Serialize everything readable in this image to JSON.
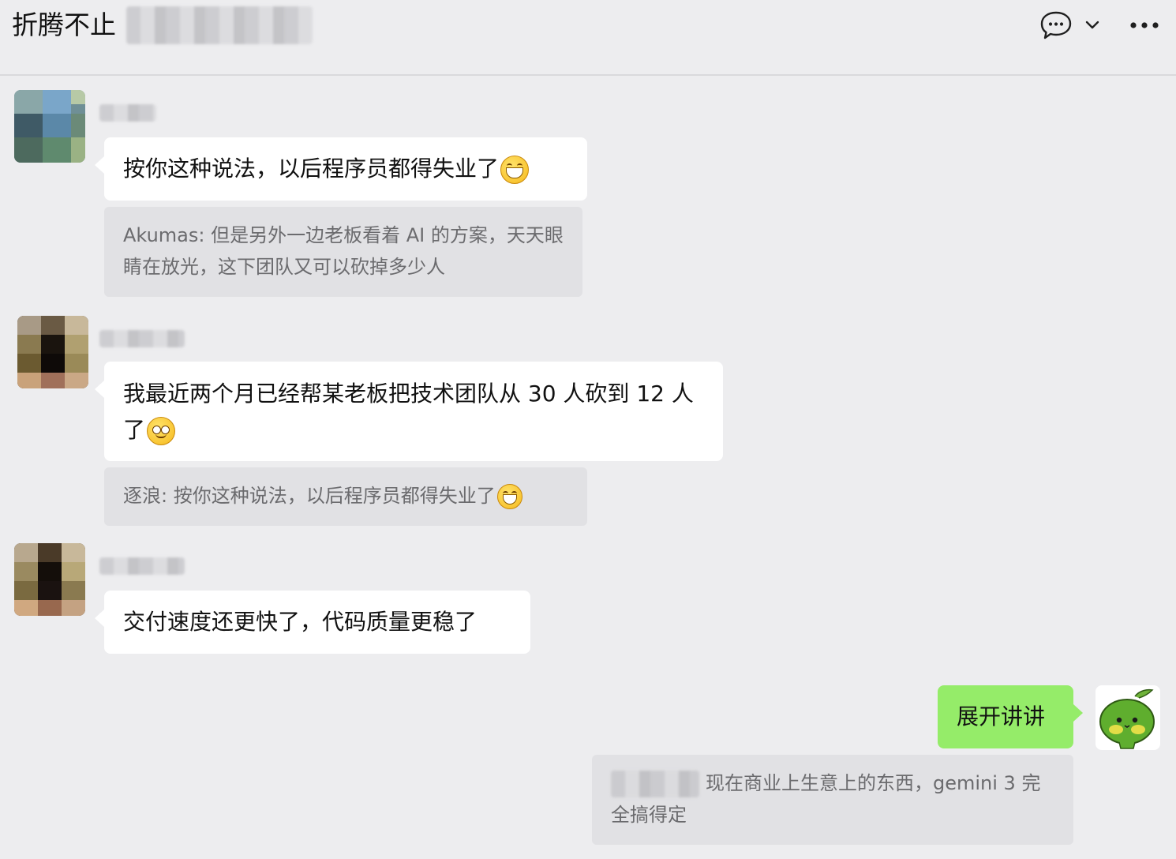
{
  "header": {
    "title": "折腾不止",
    "icons": [
      "chat-bubble-icon",
      "chevron-down-icon",
      "more-icon"
    ]
  },
  "messages": [
    {
      "sender": "other",
      "text": "按你这种说法，以后程序员都得失业了",
      "emoji": "grin-emoji",
      "quote": {
        "author": "Akumas",
        "text": "Akumas: 但是另外一边老板看着 AI 的方案，天天眼睛在放光，这下团队又可以砍掉多少人"
      }
    },
    {
      "sender": "other",
      "text": "我最近两个月已经帮某老板把技术团队从 30 人砍到 12 人了",
      "emoji": "awkward-emoji",
      "quote": {
        "author": "逐浪",
        "text": "逐浪: 按你这种说法，以后程序员都得失业了",
        "emoji": "grin-emoji"
      }
    },
    {
      "sender": "other",
      "text": "交付速度还更快了，代码质量更稳了"
    },
    {
      "sender": "me",
      "text": "展开讲讲",
      "quote": {
        "text": "现在商业上生意上的东西，gemini 3 完全搞得定"
      }
    }
  ],
  "colors": {
    "background": "#ededef",
    "bubble_other": "#ffffff",
    "bubble_me": "#95ec69",
    "quote_bg": "#e1e1e4",
    "quote_text": "#6b6b6e"
  }
}
